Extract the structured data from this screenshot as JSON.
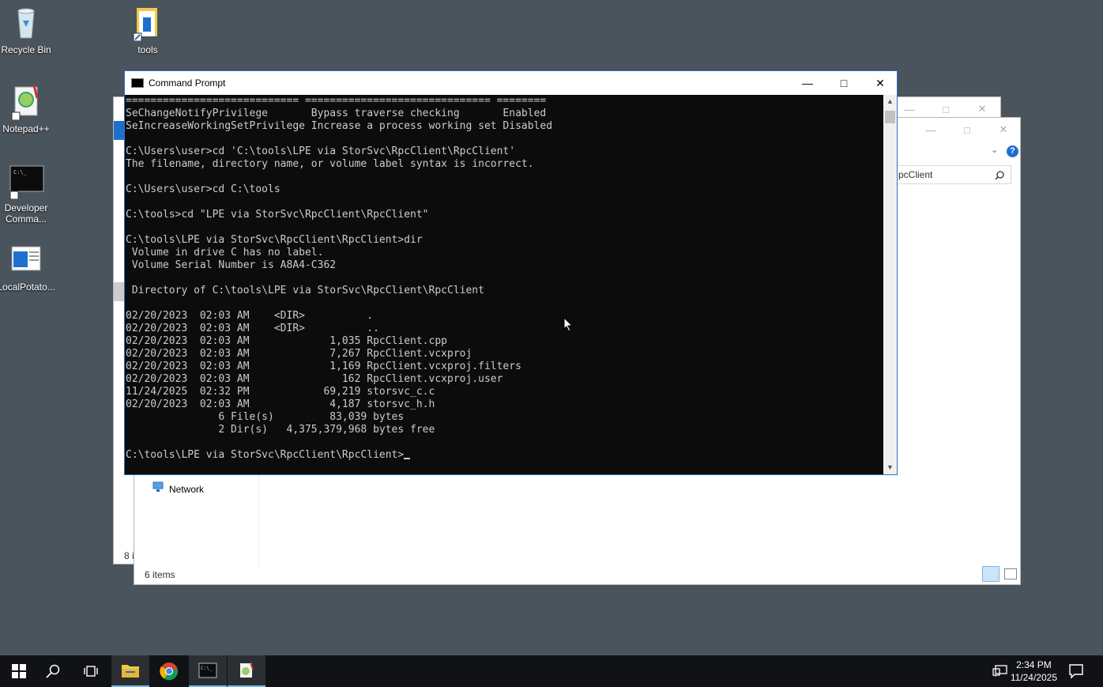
{
  "desktop": {
    "icons": [
      {
        "label": "Recycle Bin"
      },
      {
        "label": "tools"
      },
      {
        "label": "Notepad++"
      },
      {
        "label": "Developer Comma..."
      },
      {
        "label": "LocalPotato..."
      }
    ]
  },
  "explorer_back": {
    "search_text": "pcClient",
    "nav_network": "Network",
    "status_items": "6 items",
    "status_left": "8 i"
  },
  "cmd": {
    "title": "Command Prompt",
    "lines": [
      "============================ ============================== ========",
      "SeChangeNotifyPrivilege       Bypass traverse checking       Enabled",
      "SeIncreaseWorkingSetPrivilege Increase a process working set Disabled",
      "",
      "C:\\Users\\user>cd 'C:\\tools\\LPE via StorSvc\\RpcClient\\RpcClient'",
      "The filename, directory name, or volume label syntax is incorrect.",
      "",
      "C:\\Users\\user>cd C:\\tools",
      "",
      "C:\\tools>cd \"LPE via StorSvc\\RpcClient\\RpcClient\"",
      "",
      "C:\\tools\\LPE via StorSvc\\RpcClient\\RpcClient>dir",
      " Volume in drive C has no label.",
      " Volume Serial Number is A8A4-C362",
      "",
      " Directory of C:\\tools\\LPE via StorSvc\\RpcClient\\RpcClient",
      "",
      "02/20/2023  02:03 AM    <DIR>          .",
      "02/20/2023  02:03 AM    <DIR>          ..",
      "02/20/2023  02:03 AM             1,035 RpcClient.cpp",
      "02/20/2023  02:03 AM             7,267 RpcClient.vcxproj",
      "02/20/2023  02:03 AM             1,169 RpcClient.vcxproj.filters",
      "02/20/2023  02:03 AM               162 RpcClient.vcxproj.user",
      "11/24/2025  02:32 PM            69,219 storsvc_c.c",
      "02/20/2023  02:03 AM             4,187 storsvc_h.h",
      "               6 File(s)         83,039 bytes",
      "               2 Dir(s)   4,375,379,968 bytes free",
      "",
      "C:\\tools\\LPE via StorSvc\\RpcClient\\RpcClient>"
    ]
  },
  "taskbar": {
    "time": "2:34 PM",
    "date": "11/24/2025"
  }
}
